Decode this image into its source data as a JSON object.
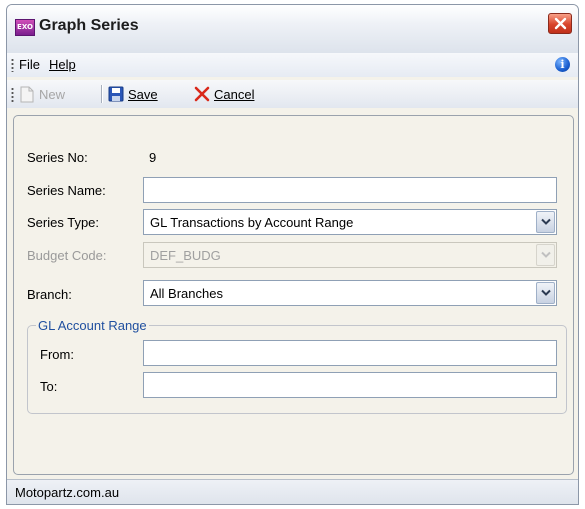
{
  "window": {
    "title": "Graph Series",
    "icon_text": "EXO"
  },
  "menu": {
    "file": "File",
    "help": "Help"
  },
  "toolbar": {
    "new": "New",
    "save": "Save",
    "cancel": "Cancel"
  },
  "form": {
    "series_no_label": "Series No:",
    "series_no_value": "9",
    "series_name_label": "Series Name:",
    "series_name_value": "",
    "series_type_label": "Series Type:",
    "series_type_value": "GL Transactions by Account Range",
    "budget_code_label": "Budget Code:",
    "budget_code_value": "DEF_BUDG",
    "branch_label": "Branch:",
    "branch_value": "All Branches"
  },
  "gl_range": {
    "legend": "GL Account Range",
    "from_label": "From:",
    "from_value": "",
    "to_label": "To:",
    "to_value": ""
  },
  "status": {
    "text": "Motopartz.com.au"
  },
  "colors": {
    "legend": "#1f4f9f",
    "close": "#d8452c",
    "cancel_x": "#d9281a",
    "save_blue": "#2a56b8"
  }
}
